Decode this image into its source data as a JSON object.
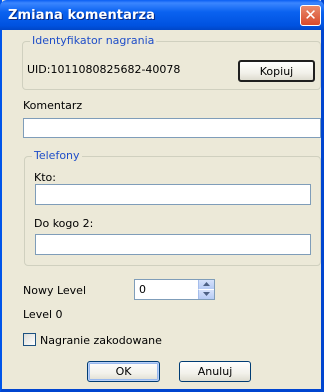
{
  "window": {
    "title": "Zmiana komentarza",
    "close_symbol": "✕"
  },
  "recording_id": {
    "legend": "Identyfikator nagrania",
    "value": "UID:1011080825682-40078",
    "copy_label": "Kopiuj"
  },
  "comment": {
    "label": "Komentarz",
    "value": ""
  },
  "phones": {
    "legend": "Telefony",
    "who_label": "Kto:",
    "who_value": "",
    "to_whom_label": "Do kogo 2:",
    "to_whom_value": ""
  },
  "level": {
    "label": "Nowy Level",
    "value": "0",
    "current": "Level 0"
  },
  "encoded": {
    "label": "Nagranie zakodowane",
    "checked": false
  },
  "buttons": {
    "ok_label": "OK",
    "cancel_label": "Anuluj"
  }
}
